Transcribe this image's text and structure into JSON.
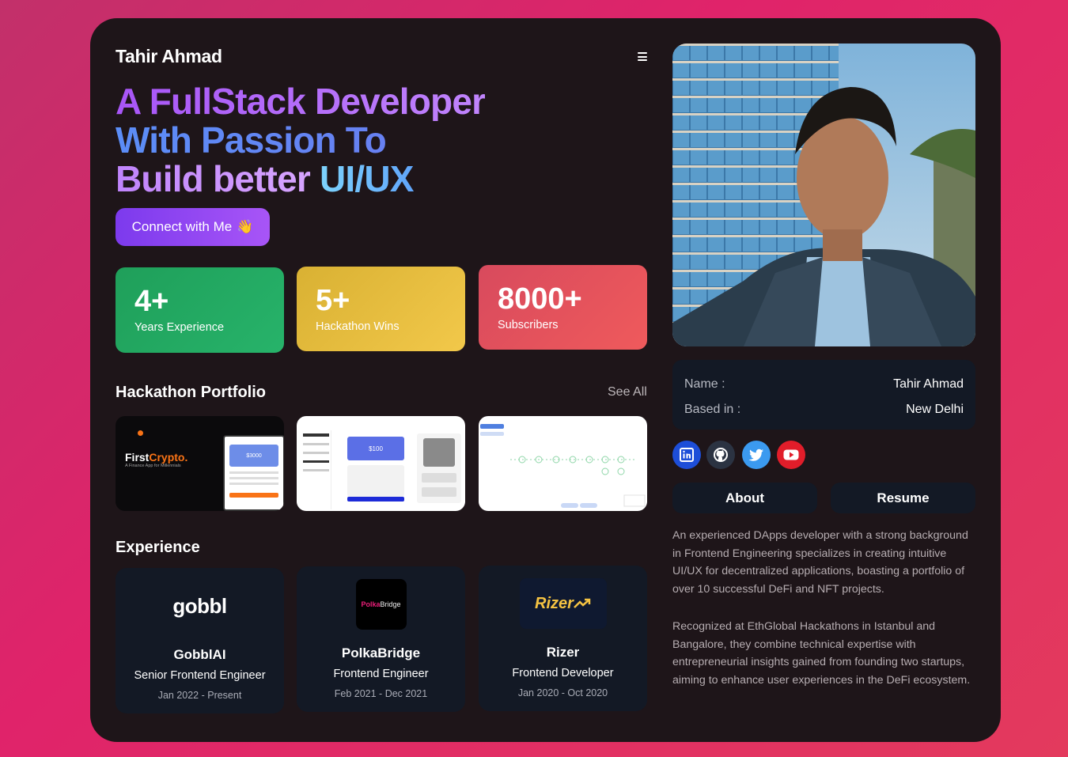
{
  "brand": "Tahir Ahmad",
  "headline": {
    "line1": "A FullStack Developer",
    "line2": "With Passion To",
    "line3a": "Build better ",
    "line3b": "UI/UX"
  },
  "cta": {
    "label": "Connect with Me",
    "emoji": "👋"
  },
  "stats": [
    {
      "value": "4+",
      "label": "Years Experience",
      "color": "#27b36a"
    },
    {
      "value": "5+",
      "label": "Hackathon Wins",
      "color": "#f2c84a"
    },
    {
      "value": "8000+",
      "label": "Subscribers",
      "color": "#ef5a5c"
    }
  ],
  "portfolio": {
    "title": "Hackathon Portfolio",
    "see_all": "See All",
    "items": [
      {
        "name_a": "First",
        "name_b": "Crypto.",
        "tagline": "A Finance App for Millennials",
        "amount": "$3000"
      },
      {
        "amount": "$100"
      },
      {}
    ]
  },
  "experience": {
    "title": "Experience",
    "items": [
      {
        "logo": "gobbl",
        "company": "GobblAI",
        "role": "Senior Frontend Engineer",
        "dates": "Jan 2022 - Present"
      },
      {
        "logo_a": "Polka",
        "logo_b": "Bridge",
        "company": "PolkaBridge",
        "role": "Frontend Engineer",
        "dates": "Feb 2021 - Dec 2021"
      },
      {
        "logo": "Rizer",
        "company": "Rizer",
        "role": "Frontend Developer",
        "dates": "Jan 2020 - Oct 2020"
      }
    ]
  },
  "profile": {
    "name_label": "Name :",
    "name_value": "Tahir Ahmad",
    "based_label": "Based in :",
    "based_value": "New Delhi"
  },
  "social": [
    {
      "icon": "linkedin-icon",
      "color": "#1d4ed8"
    },
    {
      "icon": "github-icon",
      "color": "#2b3342"
    },
    {
      "icon": "twitter-icon",
      "color": "#3b9af0"
    },
    {
      "icon": "youtube-icon",
      "color": "#e11d2a"
    }
  ],
  "tabs": {
    "about": "About",
    "resume": "Resume"
  },
  "about": {
    "p1": "An experienced DApps developer with a strong background in Frontend Engineering specializes in creating intuitive UI/UX for decentralized applications, boasting a portfolio of over 10 successful DeFi and NFT projects.",
    "p2": "Recognized at EthGlobal Hackathons in Istanbul and Bangalore, they combine technical expertise with entrepreneurial insights gained from founding two startups, aiming to enhance user experiences in the DeFi ecosystem."
  }
}
